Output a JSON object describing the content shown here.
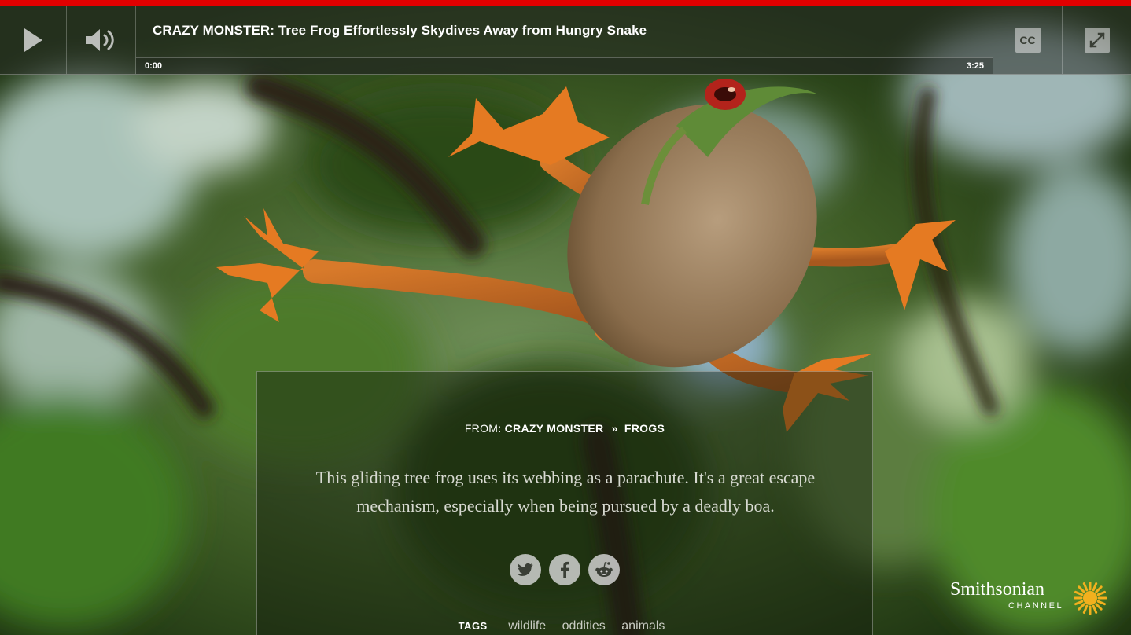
{
  "colors": {
    "accent": "#e10000",
    "panel_text": "#d8dad2",
    "tag_text": "#c9ccc3",
    "brand_sun": "#f2b01e"
  },
  "player": {
    "play_icon": "play-icon",
    "volume_icon": "volume-icon",
    "title": "CRAZY MONSTER: Tree Frog Effortlessly Skydives Away from Hungry Snake",
    "current_time": "0:00",
    "duration": "3:25",
    "progress": 0.0,
    "cc_label": "CC",
    "fullscreen_icon": "fullscreen-icon"
  },
  "info": {
    "from_label": "FROM:",
    "show_name": "CRAZY MONSTER",
    "separator": "»",
    "category": "FROGS",
    "description": "This gliding tree frog uses its webbing as a parachute. It's a great escape mechanism, especially when being pursued by a deadly boa.",
    "share": [
      {
        "name": "twitter-icon"
      },
      {
        "name": "facebook-icon"
      },
      {
        "name": "reddit-icon"
      }
    ],
    "tags_label": "TAGS",
    "tags": [
      "wildlife",
      "oddities",
      "animals"
    ]
  },
  "brand": {
    "name": "Smithsonian",
    "sub": "CHANNEL",
    "logo_icon": "sun-icon"
  }
}
